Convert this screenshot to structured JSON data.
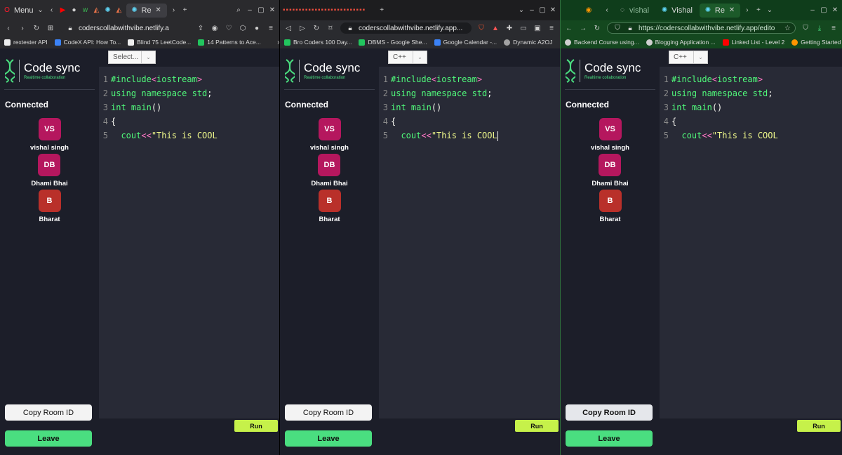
{
  "windows": [
    {
      "id": "opera",
      "tabs": {
        "menu_label": "Menu",
        "active_tab": "Re"
      },
      "url": "coderscollabwithvibe.netlify.a",
      "bookmarks": [
        "rextester API",
        "CodeX API: How To...",
        "Blind 75 LeetCode...",
        "14 Patterns to Ace..."
      ],
      "language": "Select...",
      "show_cursor": false
    },
    {
      "id": "brave",
      "tabs": {
        "active_tab": ""
      },
      "url": "coderscollabwithvibe.netlify.app...",
      "bookmarks": [
        "Bro Coders 100 Day...",
        "DBMS - Google She...",
        "Google Calendar -...",
        "Dynamic A2OJ"
      ],
      "language": "C++",
      "show_cursor": true
    },
    {
      "id": "firefox",
      "tabs": {
        "tab1": "vishal",
        "tab2": "Vishal",
        "active_tab": "Re"
      },
      "url": "https://coderscollabwithvibe.netlify.app/edito",
      "bookmarks": [
        "Backend Course using...",
        "Blogging Application ...",
        "Linked List - Level 2",
        "Getting Started"
      ],
      "language": "C++",
      "show_cursor": false
    }
  ],
  "app": {
    "logo_title": "Code sync",
    "logo_subtitle": "Realtime collaboration",
    "connected_label": "Connected",
    "clients": [
      {
        "initials": "VS",
        "name": "vishal singh",
        "color": "#b5175e"
      },
      {
        "initials": "DB",
        "name": "Dhami Bhai",
        "color": "#b5175e"
      },
      {
        "initials": "B",
        "name": "Bharat",
        "color": "#b9302a"
      }
    ],
    "copy_label": "Copy Room ID",
    "leave_label": "Leave",
    "run_label": "Run",
    "code_lines": [
      {
        "num": "1",
        "tokens": [
          {
            "t": "#include",
            "c": "pp"
          },
          {
            "t": "<",
            "c": "ang"
          },
          {
            "t": "iostream",
            "c": "kw"
          },
          {
            "t": ">",
            "c": "ang"
          }
        ]
      },
      {
        "num": "2",
        "tokens": [
          {
            "t": "using namespace std",
            "c": "kw"
          },
          {
            "t": ";",
            "c": "pl"
          }
        ]
      },
      {
        "num": "3",
        "tokens": [
          {
            "t": "int",
            "c": "kw"
          },
          {
            "t": " ",
            "c": "pl"
          },
          {
            "t": "main",
            "c": "kw"
          },
          {
            "t": "()",
            "c": "pl"
          }
        ]
      },
      {
        "num": "4",
        "tokens": [
          {
            "t": "{",
            "c": "pl"
          }
        ]
      },
      {
        "num": "5",
        "tokens": [
          {
            "t": "  cout",
            "c": "kw"
          },
          {
            "t": "<<",
            "c": "op"
          },
          {
            "t": "\"This is COOL",
            "c": "st"
          }
        ]
      }
    ]
  },
  "colors": {
    "accent_green": "#4ade80",
    "run_green": "#c6f14a",
    "editor_bg": "#282a36",
    "sidebar_bg": "#1c1e29"
  }
}
